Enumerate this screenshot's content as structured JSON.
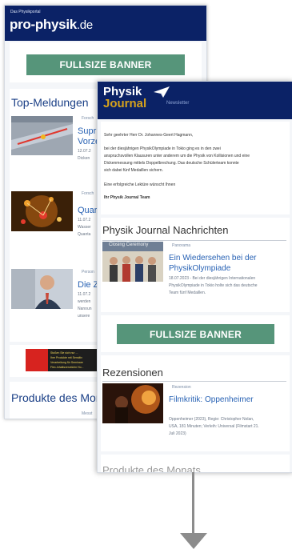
{
  "back_card": {
    "small_header": "Das Physikportal",
    "logo_main": "pro-physik",
    "logo_suffix": ".de",
    "banner": "FULLSIZE BANNER",
    "top_title": "Top-Meldungen",
    "items": [
      {
        "tag": "Forsch",
        "title": "Supr",
        "title2": "Vorze",
        "meta": [
          "12.07.2",
          "Dicken"
        ]
      },
      {
        "tag": "Forsch",
        "title": "Quar",
        "meta": [
          "11.07.2",
          "Wasser",
          "Quanta"
        ]
      },
      {
        "tag": "Person",
        "title": "Die Z",
        "meta": [
          "11.07.2",
          "werden",
          "Nanoun",
          "unsere"
        ]
      }
    ],
    "ad_text": [
      "Stoßen Sie sich nur ...",
      "Ihre Produkte mit Sensitiv",
      "Verarbeitung für Seminare",
      "Flex-Inhaltsverzeichn Ho..."
    ],
    "products_title": "Produkte des Mon",
    "products_tag": "Messt"
  },
  "front_card": {
    "logo_line1": "Physik",
    "logo_line2": "Journal",
    "logo_sub": "Newsletter",
    "letter_lines": [
      "Sehr geehrter Herr Dr. Johannes-Geert Hagmann,",
      "bei der diesjährigen PhysikOlympiade in Tokio ging es in den zwei",
      "anspruchsvollen Klausuren unter anderem um die Physik von Kollisionen und eine",
      "Dickenmessung mittels Doppelbrechung. Das deutsche Schülerteam konnte",
      "sich dabei fünf Medaillen sichern.",
      "Eine erfolgreiche Lektüre wünscht Ihnen",
      "Ihr Physik Journal Team"
    ],
    "news_title": "Physik Journal Nachrichten",
    "news_tag": "Panorama",
    "news_link": [
      "Ein Wiedersehen bei der",
      "PhysikOlympiade"
    ],
    "news_meta": [
      "18.07.2023 - Bei der diesjährigen Internationalen",
      "PhysikOlympiade in Tokio holte sich das deutsche",
      "Team fünf Medaillen."
    ],
    "news_photo_caption": "Closing Ceremony",
    "banner": "FULLSIZE BANNER",
    "reviews_title": "Rezensionen",
    "review_tag": "Rezension",
    "review_link": "Filmkritik: Oppenheimer",
    "review_meta": [
      "Oppenheimer (2023), Regie: Christopher Nolan,",
      "USA, 181 Minuten; Verleih: Universal (Filmstart 21.",
      "Juli 2023)"
    ],
    "bottom_cut_title": "Produkte des Monats"
  },
  "colors": {
    "navy": "#0b2266",
    "banner_green": "#56957a",
    "link_blue": "#2862b4",
    "arrow_gray": "#8c8c8c"
  }
}
